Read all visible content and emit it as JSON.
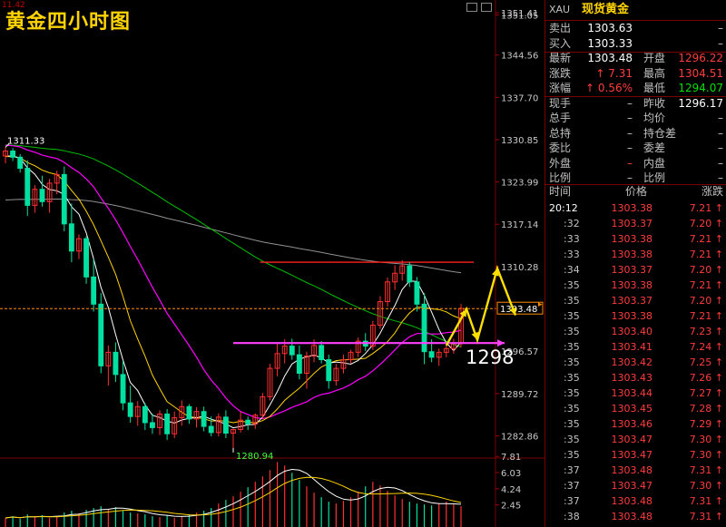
{
  "chart_title": "黄金四小时图",
  "corner_value": "11.42",
  "annotation_target": "1298",
  "chart_data": {
    "type": "candlestick",
    "ylim": [
      1280,
      1351.41
    ],
    "y_ticks": [
      "1351.41",
      "1351.05",
      "1344.56",
      "1337.70",
      "1330.85",
      "1323.99",
      "1317.14",
      "1310.28",
      "1303.43",
      "1296.57",
      "1289.72",
      "1282.86"
    ],
    "high_label": "1311.33",
    "low_label": "1280.94",
    "last_price_label": "1303.48",
    "support_line": 1297.9,
    "resistance_line": 1311.0,
    "ma_colors": {
      "ma5": "#ffffff",
      "ma10": "#ffd400",
      "ma20": "#ff00ff",
      "ma60": "#00c000",
      "ma120": "#909090"
    },
    "candles": [
      [
        1328.2,
        1329.6,
        1327.0,
        1329.0
      ],
      [
        1329.0,
        1329.5,
        1327.4,
        1328.0
      ],
      [
        1328.0,
        1328.5,
        1325.5,
        1326.2
      ],
      [
        1326.2,
        1327.5,
        1318.5,
        1320.2
      ],
      [
        1320.2,
        1323.5,
        1319.0,
        1322.8
      ],
      [
        1322.8,
        1325.0,
        1320.0,
        1320.8
      ],
      [
        1320.8,
        1324.5,
        1319.0,
        1323.8
      ],
      [
        1323.8,
        1325.8,
        1322.0,
        1325.2
      ],
      [
        1325.2,
        1326.5,
        1316.0,
        1317.2
      ],
      [
        1317.2,
        1320.5,
        1311.0,
        1312.8
      ],
      [
        1312.8,
        1315.5,
        1311.5,
        1314.8
      ],
      [
        1314.8,
        1315.2,
        1307.5,
        1308.6
      ],
      [
        1308.6,
        1311.5,
        1303.0,
        1304.2
      ],
      [
        1304.2,
        1306.0,
        1293.0,
        1294.2
      ],
      [
        1294.2,
        1297.5,
        1291.0,
        1296.4
      ],
      [
        1296.4,
        1298.0,
        1291.6,
        1292.8
      ],
      [
        1292.8,
        1295.0,
        1287.0,
        1288.2
      ],
      [
        1288.2,
        1291.0,
        1285.0,
        1286.0
      ],
      [
        1286.0,
        1288.5,
        1284.5,
        1287.6
      ],
      [
        1287.6,
        1288.2,
        1283.8,
        1285.0
      ],
      [
        1285.0,
        1286.5,
        1283.2,
        1284.2
      ],
      [
        1284.2,
        1287.0,
        1283.0,
        1286.4
      ],
      [
        1286.4,
        1287.2,
        1282.2,
        1283.2
      ],
      [
        1283.2,
        1286.8,
        1282.5,
        1285.8
      ],
      [
        1285.8,
        1288.6,
        1284.5,
        1287.6
      ],
      [
        1287.6,
        1288.0,
        1284.8,
        1285.6
      ],
      [
        1285.6,
        1287.5,
        1284.2,
        1286.8
      ],
      [
        1286.8,
        1287.6,
        1283.6,
        1284.4
      ],
      [
        1284.4,
        1286.0,
        1282.8,
        1283.4
      ],
      [
        1283.4,
        1286.5,
        1282.8,
        1285.9
      ],
      [
        1285.9,
        1287.0,
        1282.5,
        1283.3
      ],
      [
        1283.3,
        1284.0,
        1280.9,
        1283.9
      ],
      [
        1283.9,
        1286.8,
        1283.4,
        1285.4
      ],
      [
        1285.4,
        1286.0,
        1283.8,
        1284.8
      ],
      [
        1284.8,
        1286.5,
        1284.0,
        1286.2
      ],
      [
        1286.2,
        1289.8,
        1285.6,
        1289.2
      ],
      [
        1289.2,
        1294.5,
        1288.6,
        1293.8
      ],
      [
        1293.8,
        1297.8,
        1292.5,
        1296.2
      ],
      [
        1296.2,
        1298.5,
        1294.6,
        1297.4
      ],
      [
        1297.4,
        1298.6,
        1295.2,
        1296.0
      ],
      [
        1296.0,
        1297.5,
        1292.0,
        1293.0
      ],
      [
        1293.0,
        1296.5,
        1290.5,
        1295.8
      ],
      [
        1295.8,
        1298.5,
        1294.8,
        1297.5
      ],
      [
        1297.5,
        1298.2,
        1294.6,
        1295.2
      ],
      [
        1295.2,
        1296.0,
        1290.5,
        1291.8
      ],
      [
        1291.8,
        1294.5,
        1291.0,
        1293.8
      ],
      [
        1293.8,
        1296.0,
        1293.0,
        1295.2
      ],
      [
        1295.2,
        1296.8,
        1294.6,
        1296.4
      ],
      [
        1296.4,
        1298.8,
        1295.6,
        1298.2
      ],
      [
        1298.2,
        1299.5,
        1296.6,
        1297.4
      ],
      [
        1297.4,
        1301.5,
        1296.8,
        1300.8
      ],
      [
        1300.8,
        1305.5,
        1300.2,
        1304.6
      ],
      [
        1304.6,
        1308.5,
        1303.8,
        1307.8
      ],
      [
        1307.8,
        1310.5,
        1306.5,
        1309.2
      ],
      [
        1309.2,
        1311.3,
        1308.0,
        1310.4
      ],
      [
        1310.4,
        1311.0,
        1307.0,
        1307.8
      ],
      [
        1307.8,
        1308.6,
        1303.0,
        1304.2
      ],
      [
        1304.2,
        1306.0,
        1294.5,
        1296.5
      ],
      [
        1296.5,
        1298.5,
        1294.8,
        1295.6
      ],
      [
        1295.6,
        1297.0,
        1294.2,
        1296.4
      ],
      [
        1296.4,
        1297.5,
        1295.6,
        1297.0
      ],
      [
        1297.0,
        1298.6,
        1296.2,
        1297.8
      ],
      [
        1297.8,
        1304.2,
        1297.2,
        1303.5
      ]
    ],
    "volumes": [
      1.0,
      1.2,
      0.9,
      1.4,
      1.1,
      1.3,
      1.0,
      1.2,
      1.6,
      1.8,
      1.5,
      1.9,
      2.1,
      2.3,
      2.0,
      2.2,
      1.8,
      1.6,
      1.5,
      1.4,
      1.2,
      1.1,
      1.3,
      1.0,
      1.2,
      1.4,
      1.6,
      1.8,
      2.1,
      2.6,
      3.0,
      3.4,
      3.9,
      4.4,
      5.0,
      5.6,
      6.3,
      7.2,
      6.8,
      6.0,
      5.2,
      4.5,
      3.8,
      3.3,
      2.8,
      2.6,
      2.9,
      3.3,
      3.9,
      4.5,
      5.0,
      4.6,
      4.0,
      3.5,
      3.1,
      2.8,
      2.6,
      2.5,
      2.4,
      2.6,
      2.8,
      2.5,
      2.3
    ],
    "volume_ticks": [
      "7.81",
      "6.03",
      "4.24",
      "2.45"
    ]
  },
  "quote": {
    "symbol": "XAU",
    "name": "现货黄金",
    "rows": [
      {
        "l1": "卖出",
        "v1": "1303.63",
        "l2": "",
        "v2": "–"
      },
      {
        "l1": "买入",
        "v1": "1303.33",
        "l2": "",
        "v2": "–"
      },
      {
        "l1": "最新",
        "v1": "1303.48",
        "l2": "开盘",
        "v2": "1296.22"
      },
      {
        "l1": "涨跌",
        "v1": "↑ 7.31",
        "l2": "最高",
        "v2": "1304.51"
      },
      {
        "l1": "涨幅",
        "v1": "↑ 0.56%",
        "l2": "最低",
        "v2": "1294.07"
      },
      {
        "l1": "现手",
        "v1": "–",
        "l2": "昨收",
        "v2": "1296.17"
      },
      {
        "l1": "总手",
        "v1": "–",
        "l2": "均价",
        "v2": "–"
      },
      {
        "l1": "总持",
        "v1": "–",
        "l2": "持仓差",
        "v2": "–"
      },
      {
        "l1": "委比",
        "v1": "–",
        "l2": "委差",
        "v2": "–"
      },
      {
        "l1": "外盘",
        "v1": "–",
        "l2": "内盘",
        "v2": "–"
      },
      {
        "l1": "比例",
        "v1": "–",
        "l2": "比例",
        "v2": "–"
      }
    ],
    "tick_header": {
      "time": "时间",
      "price": "价格",
      "change": "涨跌"
    },
    "ticks": [
      {
        "t": "20:12",
        "p": "1303.38",
        "c": "7.21 ↑"
      },
      {
        "t": ":32",
        "p": "1303.37",
        "c": "7.20 ↑"
      },
      {
        "t": ":33",
        "p": "1303.38",
        "c": "7.21 ↑"
      },
      {
        "t": ":33",
        "p": "1303.38",
        "c": "7.21 ↑"
      },
      {
        "t": ":34",
        "p": "1303.37",
        "c": "7.20 ↑"
      },
      {
        "t": ":35",
        "p": "1303.38",
        "c": "7.21 ↑"
      },
      {
        "t": ":35",
        "p": "1303.37",
        "c": "7.20 ↑"
      },
      {
        "t": ":35",
        "p": "1303.38",
        "c": "7.21 ↑"
      },
      {
        "t": ":35",
        "p": "1303.40",
        "c": "7.23 ↑"
      },
      {
        "t": ":35",
        "p": "1303.41",
        "c": "7.24 ↑"
      },
      {
        "t": ":35",
        "p": "1303.42",
        "c": "7.25 ↑"
      },
      {
        "t": ":35",
        "p": "1303.43",
        "c": "7.26 ↑"
      },
      {
        "t": ":35",
        "p": "1303.44",
        "c": "7.27 ↑"
      },
      {
        "t": ":35",
        "p": "1303.45",
        "c": "7.28 ↑"
      },
      {
        "t": ":35",
        "p": "1303.46",
        "c": "7.29 ↑"
      },
      {
        "t": ":35",
        "p": "1303.47",
        "c": "7.30 ↑"
      },
      {
        "t": ":35",
        "p": "1303.47",
        "c": "7.30 ↑"
      },
      {
        "t": ":37",
        "p": "1303.48",
        "c": "7.31 ↑"
      },
      {
        "t": ":37",
        "p": "1303.47",
        "c": "7.30 ↑"
      },
      {
        "t": ":37",
        "p": "1303.48",
        "c": "7.31 ↑"
      },
      {
        "t": ":38",
        "p": "1303.48",
        "c": "7.31 ↑"
      }
    ]
  }
}
